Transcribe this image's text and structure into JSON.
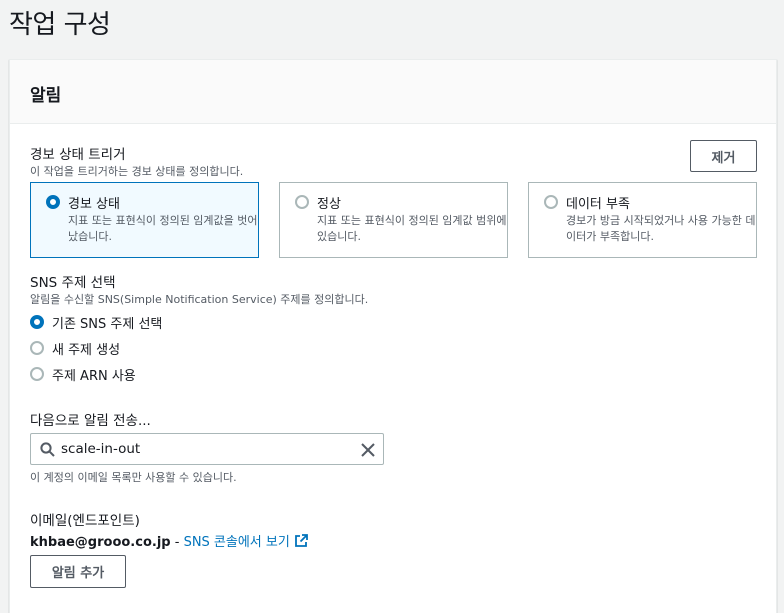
{
  "page": {
    "title": "작업 구성"
  },
  "notification": {
    "title": "알림",
    "remove_label": "제거",
    "alarm_trigger": {
      "label": "경보 상태 트리거",
      "description": "이 작업을 트리거하는 경보 상태를 정의합니다.",
      "options": [
        {
          "label": "경보 상태",
          "description": "지표 또는 표현식이 정의된 임계값을 벗어났습니다.",
          "selected": true
        },
        {
          "label": "정상",
          "description": "지표 또는 표현식이 정의된 임계값 범위에 있습니다.",
          "selected": false
        },
        {
          "label": "데이터 부족",
          "description": "경보가 방금 시작되었거나 사용 가능한 데이터가 부족합니다.",
          "selected": false
        }
      ]
    },
    "sns_topic": {
      "label": "SNS 주제 선택",
      "description": "알림을 수신할 SNS(Simple Notification Service) 주제를 정의합니다.",
      "options": [
        {
          "label": "기존 SNS 주제 선택",
          "selected": true
        },
        {
          "label": "새 주제 생성",
          "selected": false
        },
        {
          "label": "주제 ARN 사용",
          "selected": false
        }
      ]
    },
    "send_to": {
      "label": "다음으로 알림 전송...",
      "value": "scale-in-out",
      "hint": "이 계정의 이메일 목록만 사용할 수 있습니다."
    },
    "email": {
      "label": "이메일(엔드포인트)",
      "address": "khbae@grooo.co.jp",
      "separator": " - ",
      "console_link": "SNS 콘솔에서 보기"
    },
    "add_label": "알림 추가"
  },
  "colors": {
    "accent": "#0073bb",
    "border": "#aab7b8",
    "text": "#16191f",
    "muted": "#545b64"
  }
}
